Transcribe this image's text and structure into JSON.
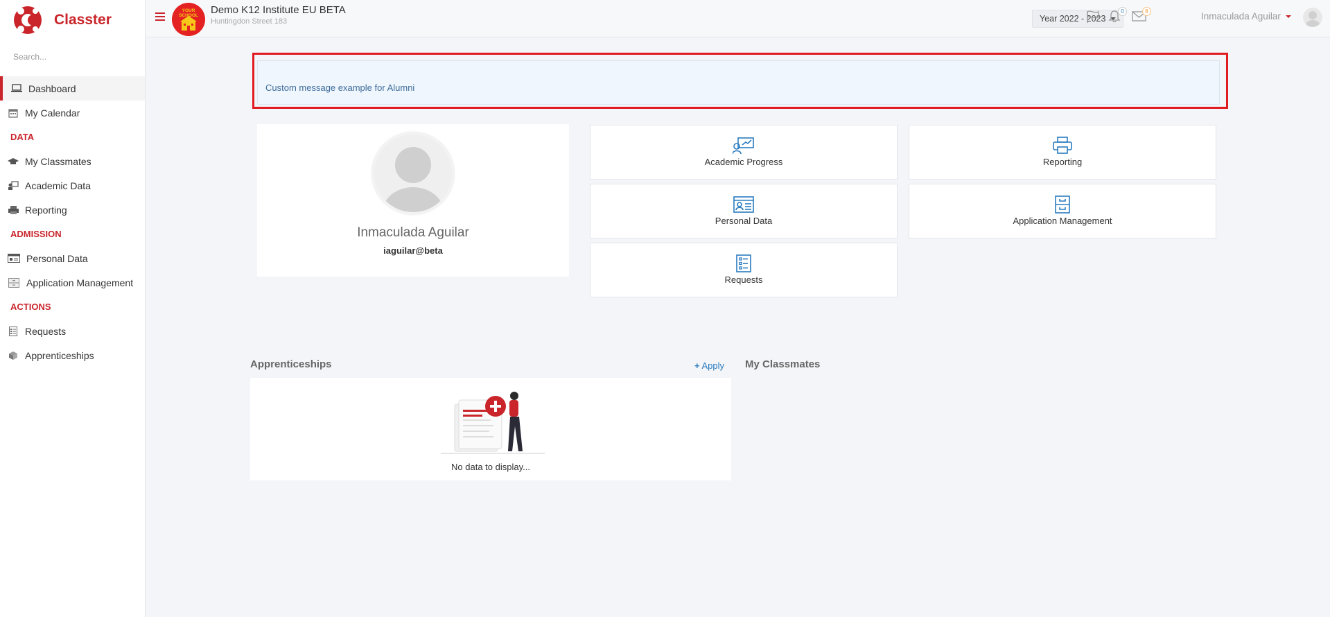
{
  "brand": {
    "name": "Classter"
  },
  "sidebar": {
    "search_placeholder": "Search...",
    "items": [
      {
        "label": "Dashboard",
        "icon": "laptop-icon"
      },
      {
        "label": "My Calendar",
        "icon": "calendar-icon"
      }
    ],
    "sections": [
      {
        "title": "DATA",
        "items": [
          {
            "label": "My Classmates",
            "icon": "graduation-cap-icon"
          },
          {
            "label": "Academic Data",
            "icon": "user-board-icon"
          },
          {
            "label": "Reporting",
            "icon": "printer-icon"
          }
        ]
      },
      {
        "title": "ADMISSION",
        "items": [
          {
            "label": "Personal Data",
            "icon": "id-card-icon"
          },
          {
            "label": "Application Management",
            "icon": "cabinet-icon"
          }
        ]
      },
      {
        "title": "ACTIONS",
        "items": [
          {
            "label": "Requests",
            "icon": "list-icon"
          },
          {
            "label": "Apprenticeships",
            "icon": "box-icon"
          }
        ]
      }
    ]
  },
  "header": {
    "school_name": "Demo K12 Institute EU BETA",
    "school_address": "Huntingdon Street 183",
    "school_logo_text": "YOUR SCHOOL",
    "year": "Year 2022 - 2023",
    "notifications_count": "0",
    "messages_count": "8",
    "user_name": "Inmaculada Aguilar"
  },
  "alert": {
    "message": "Custom message example for Alumni"
  },
  "profile": {
    "name": "Inmaculada Aguilar",
    "email": "iaguilar@beta"
  },
  "tiles": [
    {
      "label": "Academic Progress",
      "icon": "academic-progress-icon"
    },
    {
      "label": "Reporting",
      "icon": "printer-icon"
    },
    {
      "label": "Personal Data",
      "icon": "id-card-icon"
    },
    {
      "label": "Application Management",
      "icon": "cabinet-icon"
    },
    {
      "label": "Requests",
      "icon": "checklist-icon"
    }
  ],
  "apprenticeships": {
    "title": "Apprenticeships",
    "apply_label": "Apply",
    "empty_text": "No data to display..."
  },
  "classmates": {
    "title": "My Classmates"
  },
  "colors": {
    "brand": "#c9252b",
    "link": "#2a7bc0",
    "alert_bg": "#eff6fd",
    "highlight": "#e11b22"
  }
}
